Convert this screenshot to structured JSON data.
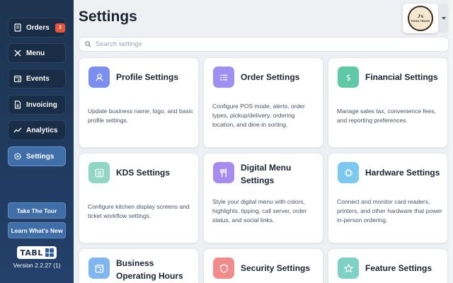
{
  "sidebar": {
    "items": [
      {
        "label": "Orders",
        "badge": "3",
        "icon": "orders-icon"
      },
      {
        "label": "Menu",
        "icon": "utensils-icon"
      },
      {
        "label": "Events",
        "icon": "calendar-icon"
      },
      {
        "label": "Invoicing",
        "icon": "invoice-icon"
      },
      {
        "label": "Analytics",
        "icon": "analytics-icon"
      },
      {
        "label": "Settings",
        "icon": "gear-icon",
        "active": true
      }
    ],
    "tour_button": "Take The Tour",
    "learn_button": "Learn What's New",
    "logo_text": "TABL",
    "version": "Version 2.2.27 (1)"
  },
  "header": {
    "title": "Settings",
    "brand_top": "J's",
    "brand_bottom": "FOOD TRUCK"
  },
  "search": {
    "placeholder": "Search settings",
    "value": ""
  },
  "cards": [
    {
      "title": "Profile Settings",
      "description": "Update business name, logo, and basic profile settings.",
      "icon": "user-icon",
      "color": "#7b8ff0"
    },
    {
      "title": "Order Settings",
      "description": "Configure POS mode, alerts, order types, pickup/delivery, ordering location, and dine-in sorting.",
      "icon": "list-icon",
      "color": "#9f8ff0"
    },
    {
      "title": "Financial Settings",
      "description": "Manage sales tax, convenience fees, and reporting preferences.",
      "icon": "dollar-icon",
      "color": "#5fc9a5"
    },
    {
      "title": "KDS Settings",
      "description": "Configure kitchen display screens and ticket workflow settings.",
      "icon": "kds-icon",
      "color": "#8fd6c4"
    },
    {
      "title": "Digital Menu Settings",
      "description": "Style your digital menu with colors, highlights, tipping, call server, order status, and social links.",
      "icon": "fork-knife-icon",
      "color": "#a68cf0"
    },
    {
      "title": "Hardware Settings",
      "description": "Connect and monitor card readers, printers, and other hardware that power in-person ordering.",
      "icon": "chip-icon",
      "color": "#7cc9ef"
    },
    {
      "title": "Business Operating Hours",
      "description": "",
      "icon": "calendar-clock-icon",
      "color": "#7fb6ef"
    },
    {
      "title": "Security Settings",
      "description": "",
      "icon": "shield-icon",
      "color": "#f28b8b"
    },
    {
      "title": "Feature Settings",
      "description": "",
      "icon": "star-icon",
      "color": "#7fd1c6"
    }
  ]
}
